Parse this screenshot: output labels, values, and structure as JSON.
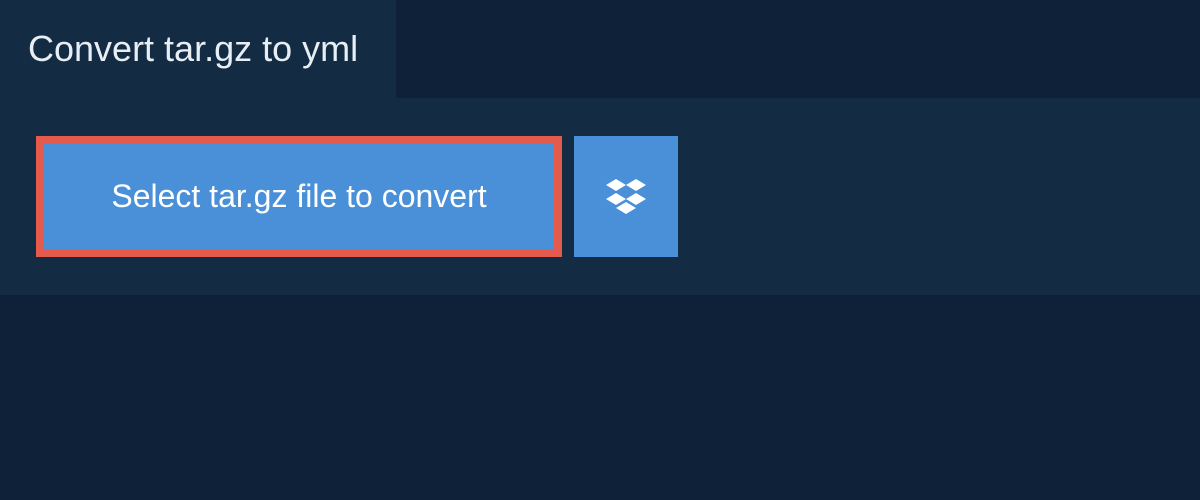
{
  "header": {
    "title": "Convert tar.gz to yml"
  },
  "actions": {
    "select_file_label": "Select tar.gz file to convert",
    "dropbox_icon": "dropbox-icon"
  },
  "colors": {
    "page_bg": "#0f2139",
    "panel_bg": "#132c44",
    "button_bg": "#4a90d9",
    "highlight_border": "#e45a4c"
  }
}
